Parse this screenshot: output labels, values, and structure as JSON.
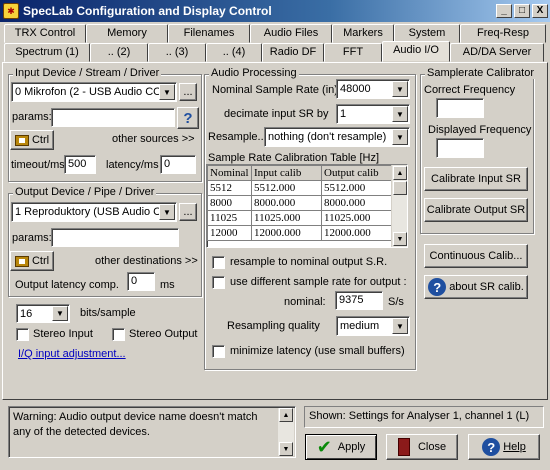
{
  "window": {
    "title": "SpecLab  Configuration and Display Control",
    "minimize": "_",
    "maximize": "□",
    "close": "X"
  },
  "tabs_row1": [
    "TRX Control",
    "Memory",
    "Filenames",
    "Audio Files",
    "Markers",
    "System",
    "Freq-Resp"
  ],
  "tabs_row2": [
    "Spectrum (1)",
    ".. (2)",
    ".. (3)",
    ".. (4)",
    "Radio DF",
    "FFT",
    "Audio I/O",
    "AD/DA Server"
  ],
  "input_group": {
    "title": "Input Device / Stream / Driver",
    "device": "0 Mikrofon (2 - USB Audio COD",
    "params_label": "params:",
    "params_value": "",
    "ctrl_label": "Ctrl",
    "other_sources": "other sources >>",
    "timeout_label": "timeout/ms",
    "timeout_value": "500",
    "latency_label": "latency/ms",
    "latency_value": "0",
    "browse": "..."
  },
  "output_group": {
    "title": "Output Device / Pipe / Driver",
    "device": "1 Reproduktory (USB Audio CC",
    "params_label": "params:",
    "params_value": "",
    "ctrl_label": "Ctrl",
    "other_destinations": "other destinations >>",
    "latency_comp_label": "Output latency comp.",
    "latency_comp_value": "0",
    "ms": "ms",
    "browse": "..."
  },
  "bits": {
    "value": "16",
    "label": "bits/sample",
    "stereo_input": "Stereo Input",
    "stereo_output": "Stereo Output",
    "iq_link": "I/Q input adjustment..."
  },
  "audio_processing": {
    "title": "Audio Processing",
    "nominal_label": "Nominal Sample Rate (in)",
    "nominal_value": "48000",
    "decimate_label": "decimate input SR by",
    "decimate_value": "1",
    "resample_label": "Resample..",
    "resample_value": "nothing (don't resample)",
    "cal_table_title": "Sample Rate Calibration Table [Hz]",
    "cal_headers": [
      "Nominal",
      "Input calib",
      "Output calib"
    ],
    "cal_rows": [
      [
        "5512",
        "5512.000",
        "5512.000"
      ],
      [
        "8000",
        "8000.000",
        "8000.000"
      ],
      [
        "11025",
        "11025.000",
        "11025.000"
      ],
      [
        "12000",
        "12000.000",
        "12000.000"
      ]
    ],
    "resample_nominal": "resample to nominal output S.R.",
    "use_different": "use different sample rate for output :",
    "nominal_out_label": "nominal:",
    "nominal_out_value": "9375",
    "sps": "S/s",
    "quality_label": "Resampling quality",
    "quality_value": "medium",
    "minimize_latency": "minimize latency (use small buffers)"
  },
  "calibrator": {
    "title": "Samplerate Calibrator",
    "correct_label": "Correct Frequency",
    "correct_value": "",
    "displayed_label": "Displayed Frequency",
    "displayed_value": "",
    "cal_input": "Calibrate Input SR",
    "cal_output": "Calibrate Output SR",
    "continuous": "Continuous Calib...",
    "about": "about SR calib."
  },
  "bottom": {
    "warning": "Warning: Audio output device name doesn't match any of the detected devices.",
    "shown": "Shown: Settings for Analyser 1, channel 1 (L)",
    "apply": "Apply",
    "close": "Close",
    "help": "Help"
  }
}
